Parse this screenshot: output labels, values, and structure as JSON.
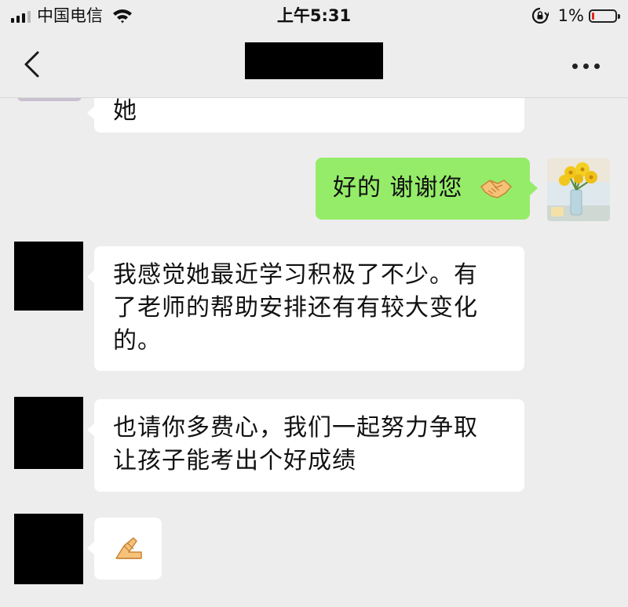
{
  "status_bar": {
    "carrier": "中国电信",
    "time": "上午5:31",
    "battery_percent": "1%",
    "battery_level": 0.01,
    "battery_color": "#e2261f",
    "icons": [
      "signal-icon",
      "wifi-icon",
      "orientation-lock-icon",
      "battery-icon"
    ]
  },
  "nav": {
    "back_icon": "chevron-left-icon",
    "title_redacted": true,
    "more_icon": "more-dots-icon"
  },
  "colors": {
    "background": "#ededed",
    "bubble_incoming": "#ffffff",
    "bubble_outgoing": "#95ec69"
  },
  "messages": [
    {
      "sender": "other",
      "text": "她",
      "truncated_top": true
    },
    {
      "sender": "me",
      "text": "好的 谢谢您 ",
      "emoji": "handshake-emoji"
    },
    {
      "sender": "other",
      "lines": [
        "我感觉她最近学习积极了不少。有",
        "了老师的帮助安排还有有较大变化",
        "的。"
      ]
    },
    {
      "sender": "other",
      "lines": [
        "也请你多费心，我们一起努力争取",
        "让孩子能考出个好成绩"
      ]
    },
    {
      "sender": "other",
      "emoji": "folded-hands-emoji"
    }
  ]
}
